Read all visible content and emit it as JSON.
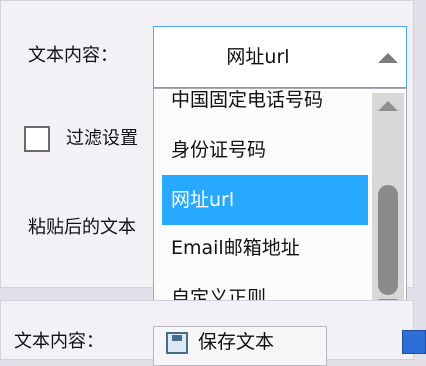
{
  "form": {
    "content_label": "文本内容：",
    "filter_label": "过滤设置",
    "paste_label": "粘贴后的文本",
    "selected_value": "网址url"
  },
  "dropdown": {
    "options": [
      {
        "label": "中国固定电话号码"
      },
      {
        "label": "身份证号码"
      },
      {
        "label": "网址url"
      },
      {
        "label": "Email邮箱地址"
      },
      {
        "label": "自定义正则"
      }
    ],
    "selected_index": 2
  },
  "bottom": {
    "content_label": "文本内容：",
    "save_button_label": "保存文本"
  },
  "icons": {
    "combo_arrow": "chevron-up-icon",
    "save": "floppy-disk-icon"
  },
  "colors": {
    "accent": "#27a9ff",
    "focus_border": "#49a8ff"
  }
}
